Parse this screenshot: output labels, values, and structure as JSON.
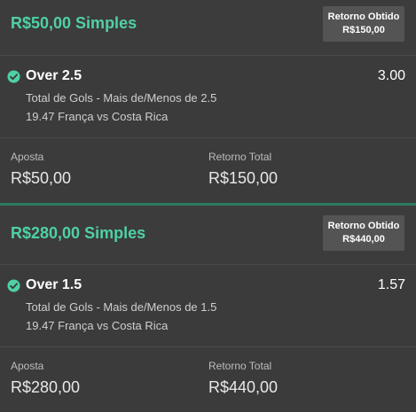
{
  "bets": [
    {
      "title": "R$50,00 Simples",
      "badge_line1": "Retorno Obtido",
      "badge_line2": "R$150,00",
      "selection": "Over 2.5",
      "odds": "3.00",
      "market": "Total de Gols - Mais de/Menos de 2.5",
      "event": "19.47 França vs Costa Rica",
      "stake_label": "Aposta",
      "stake_value": "R$50,00",
      "return_label": "Retorno Total",
      "return_value": "R$150,00"
    },
    {
      "title": "R$280,00 Simples",
      "badge_line1": "Retorno Obtido",
      "badge_line2": "R$440,00",
      "selection": "Over 1.5",
      "odds": "1.57",
      "market": "Total de Gols - Mais de/Menos de 1.5",
      "event": "19.47 França vs Costa Rica",
      "stake_label": "Aposta",
      "stake_value": "R$280,00",
      "return_label": "Retorno Total",
      "return_value": "R$440,00"
    }
  ],
  "colors": {
    "accent": "#4fd1a5",
    "background": "#3b3b3b",
    "badge": "#545454"
  },
  "icons": {
    "won": "check-circle-icon"
  }
}
